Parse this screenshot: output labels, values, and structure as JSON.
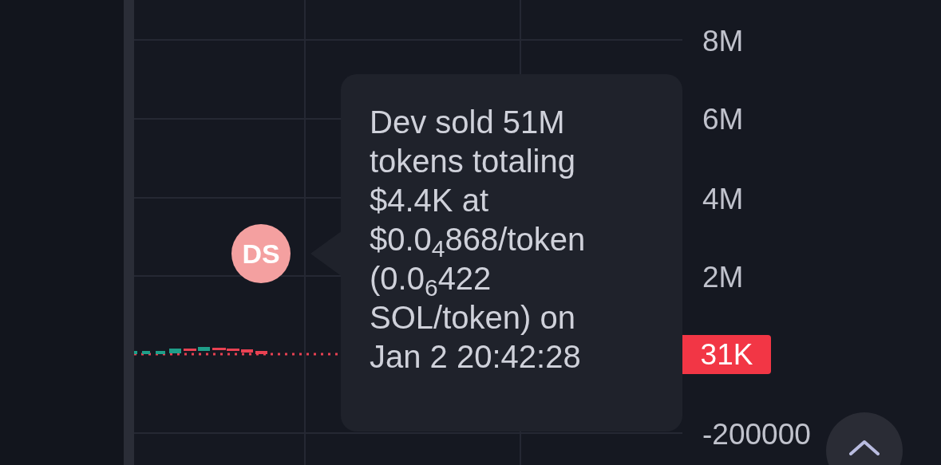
{
  "chart": {
    "y_axis_labels": [
      "8M",
      "6M",
      "4M",
      "2M",
      "-200000"
    ],
    "price_label": "31K",
    "marker": {
      "label": "DS"
    },
    "tooltip": {
      "text": "Dev sold 51M tokens totaling $4.4K at $0.0$_{4}$868/token (0.0$_{6}$422 SOL/token) on Jan 2 20:42:28"
    }
  }
}
